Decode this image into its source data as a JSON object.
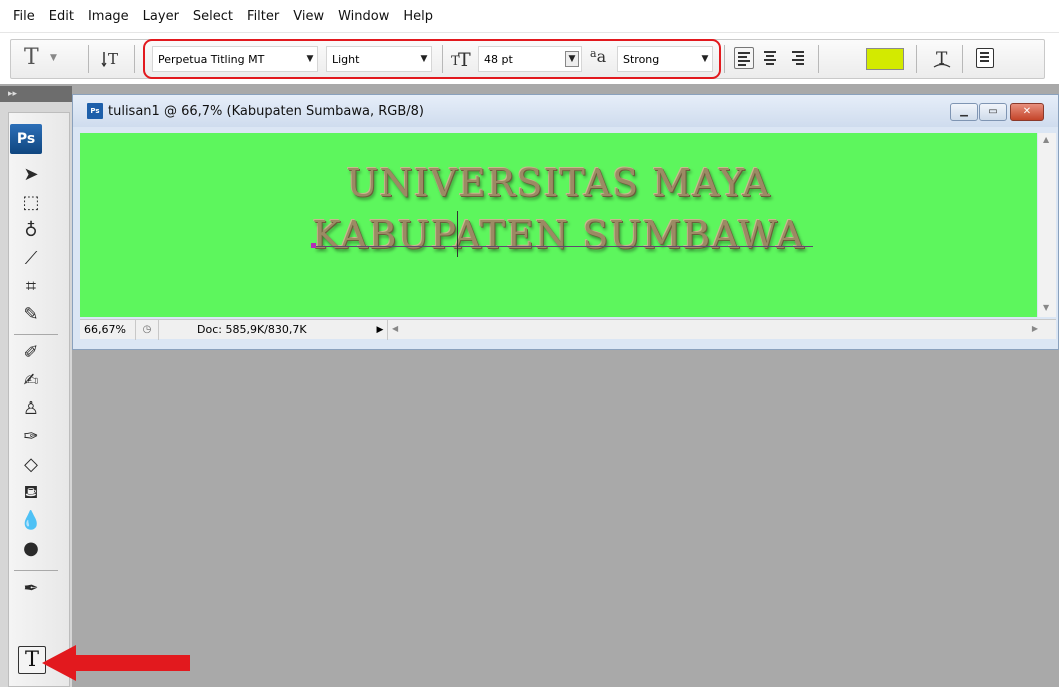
{
  "menu": [
    "File",
    "Edit",
    "Image",
    "Layer",
    "Select",
    "Filter",
    "View",
    "Window",
    "Help"
  ],
  "options": {
    "font_family": "Perpetua Titling MT",
    "font_style": "Light",
    "font_size": "48 pt",
    "antialias": "Strong",
    "text_color": "#d3ea00"
  },
  "document": {
    "title": "tulisan1 @ 66,7% (Kabupaten Sumbawa, RGB/8)",
    "canvas_color": "#5df65d",
    "lines": [
      "UNIVERSITAS MAYA",
      "KABUPATEN SUMBAWA"
    ],
    "zoom": "66,67%",
    "doc_info": "Doc: 585,9K/830,7K"
  },
  "toolbox": {
    "logo": "Ps",
    "type_tool_label": "T",
    "tools": [
      "move-tool-icon",
      "marquee-tool-icon",
      "lasso-tool-icon",
      "magic-wand-icon",
      "crop-tool-icon",
      "slice-tool-icon",
      "healing-brush-icon",
      "brush-tool-icon",
      "clone-stamp-icon",
      "history-brush-icon",
      "eraser-tool-icon",
      "paint-bucket-icon",
      "blur-tool-icon",
      "dodge-tool-icon",
      "pen-tool-icon",
      "type-tool-icon"
    ]
  },
  "tool_glyphs": {
    "options_type_icon": "T",
    "text_orientation_icon": "↓T",
    "size_icon": "T",
    "antialias_icon": "aa",
    "warp_icon": "⟆",
    "panels_icon": "▤"
  }
}
